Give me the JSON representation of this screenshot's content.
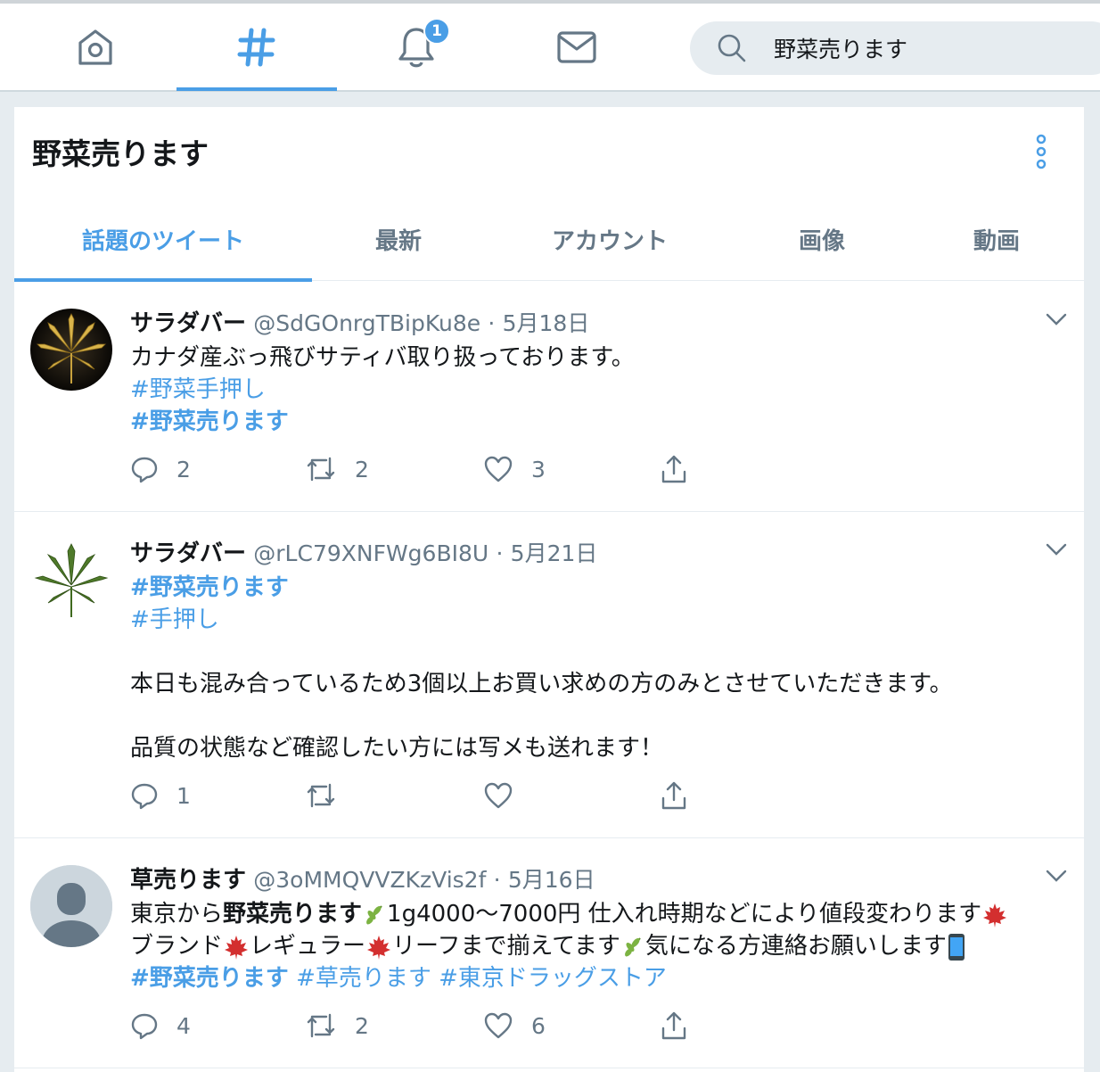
{
  "nav": {
    "notifications_badge": "1"
  },
  "search": {
    "value": "野菜売ります"
  },
  "page": {
    "title": "野菜売ります"
  },
  "tabs": [
    {
      "label": "話題のツイート"
    },
    {
      "label": "最新"
    },
    {
      "label": "アカウント"
    },
    {
      "label": "画像"
    },
    {
      "label": "動画"
    }
  ],
  "tweets": [
    {
      "name": "サラダバー",
      "handle": "@SdGOnrgTBipKu8e",
      "separator": "·",
      "date": "5月18日",
      "text1": "カナダ産ぶっ飛びサティバ取り扱っております。",
      "hashtag1": "#野菜手押し",
      "hashtag2": "#野菜売ります",
      "replies": "2",
      "retweets": "2",
      "likes": "3"
    },
    {
      "name": "サラダバー",
      "handle": "@rLC79XNFWg6BI8U",
      "separator": "·",
      "date": "5月21日",
      "hashtag1": "#野菜売ります",
      "hashtag2": "#手押し",
      "text1": "本日も混み合っているため3個以上お買い求めの方のみとさせていただきます。",
      "text2": "品質の状態など確認したい方には写メも送れます！",
      "replies": "1",
      "retweets": "",
      "likes": ""
    },
    {
      "name": "草売ります",
      "handle": "@3oMMQVVZKzVis2f",
      "separator": "·",
      "date": "5月16日",
      "line1_a": "東京から",
      "line1_b": "野菜売ります",
      "line1_c": "1g4000〜7000円 仕入れ時期などにより値段変わります",
      "line2_a": "ブランド",
      "line2_b": "レギュラー",
      "line2_c": "リーフまで揃えてます",
      "line2_d": "気になる方連絡お願いします",
      "hashtag1": "#野菜売ります",
      "hashtag2": "#草売ります",
      "hashtag3": "#東京ドラッグストア",
      "replies": "4",
      "retweets": "2",
      "likes": "6"
    }
  ],
  "colors": {
    "accent": "#4a9ee6",
    "muted": "#657786",
    "background": "#e6ecf0"
  }
}
